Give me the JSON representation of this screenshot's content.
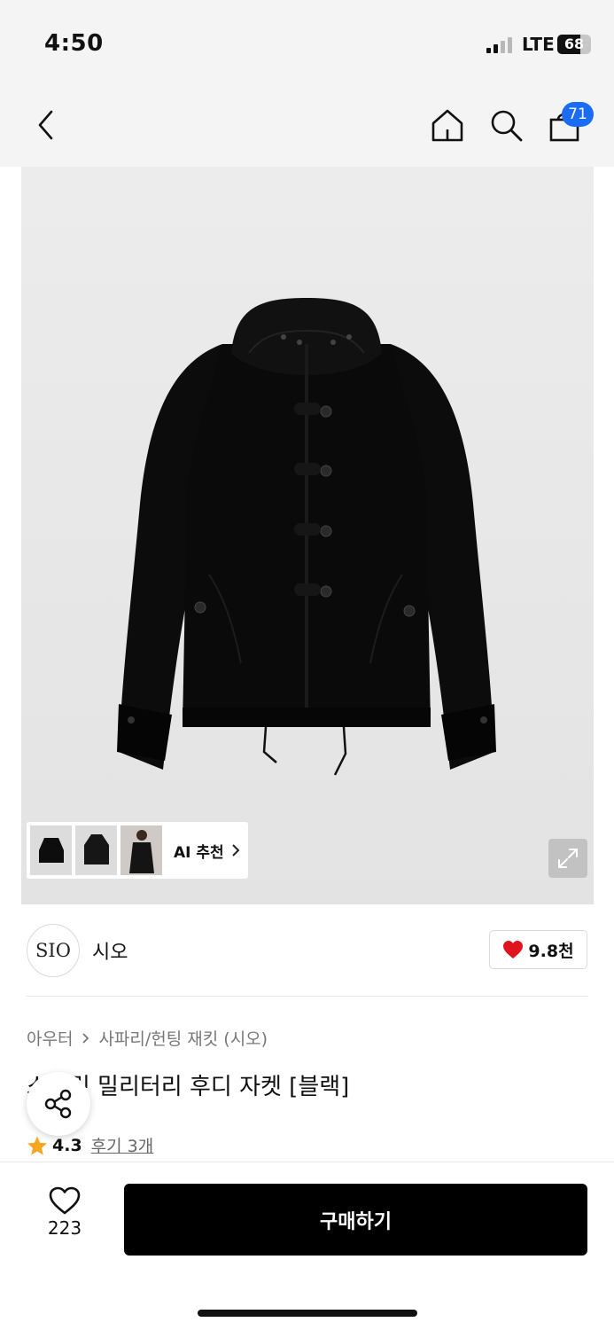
{
  "status_bar": {
    "time": "4:50",
    "network": "LTE",
    "battery": "68",
    "battery_level": 0.68
  },
  "nav": {
    "cart_count": "71"
  },
  "gallery": {
    "ai_label": "AI 추천"
  },
  "brand": {
    "logo_text": "SIO",
    "name": "시오",
    "likes": "9.8천"
  },
  "product": {
    "breadcrumb": [
      "아우터",
      "사파리/헌팅 재킷 (시오)"
    ],
    "title": "스트링 밀리터리 후디 자켓 [블랙]",
    "rating": "4.3",
    "reviews": "후기 3개"
  },
  "bottom": {
    "wish_count": "223",
    "buy_label": "구매하기"
  },
  "colors": {
    "accent_blue": "#1a6cf5",
    "heart_red": "#e0141e",
    "star_orange": "#f5a623",
    "buy_black": "#000000"
  }
}
